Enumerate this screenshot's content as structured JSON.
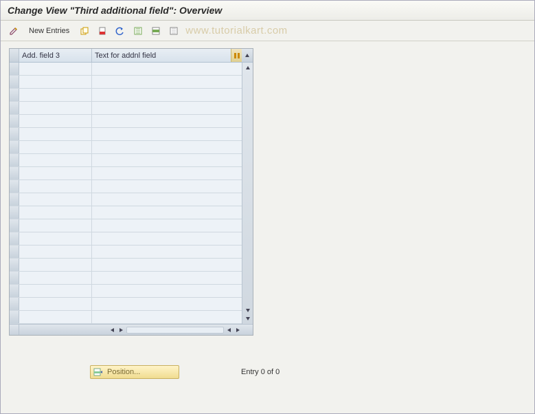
{
  "title": "Change View \"Third additional field\": Overview",
  "toolbar": {
    "new_entries": "New Entries"
  },
  "watermark": "www.tutorialkart.com",
  "grid": {
    "columns": {
      "sel": "",
      "col1": "Add. field 3",
      "col2": "Text for addnl field"
    },
    "row_count": 20
  },
  "footer": {
    "position_label": "Position...",
    "entry_text": "Entry 0 of 0"
  }
}
